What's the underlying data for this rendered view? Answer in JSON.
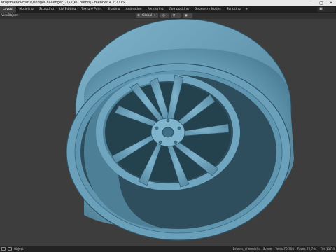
{
  "window": {
    "title": "ktop\\BlendProd\\7\\DodgeChallenger_2\\52\\PG.blend] - Blender 4.2.7 LTS",
    "controls": [
      "—",
      "▢",
      "✕"
    ]
  },
  "workspaces": {
    "tabs": [
      "Layout",
      "Modeling",
      "Sculpting",
      "UV Editing",
      "Texture Paint",
      "Shading",
      "Animation",
      "Rendering",
      "Compositing",
      "Geometry Nodes",
      "Scripting",
      "+"
    ],
    "active": "Layout",
    "scene_icon": "scene-icon"
  },
  "header": {
    "mode": "Object",
    "menu_view": "View",
    "transform_orientation": "Global",
    "pivot_icon": "pivot-icon",
    "snap_icon": "snap-icon",
    "proportional_icon": "proportional-editing-icon"
  },
  "status": {
    "left_icon": "mouse-icon",
    "left_label": "Object",
    "right_items": [
      "Drivers_xfwrmiofu",
      "Scene",
      "Verts 70,704",
      "Faces 70,704",
      "Tris 157,4"
    ]
  },
  "colors": {
    "wheel": "#6fa5bf",
    "wheel_dark": "#3e6f87",
    "viewport_bg": "#3d3d3d"
  }
}
